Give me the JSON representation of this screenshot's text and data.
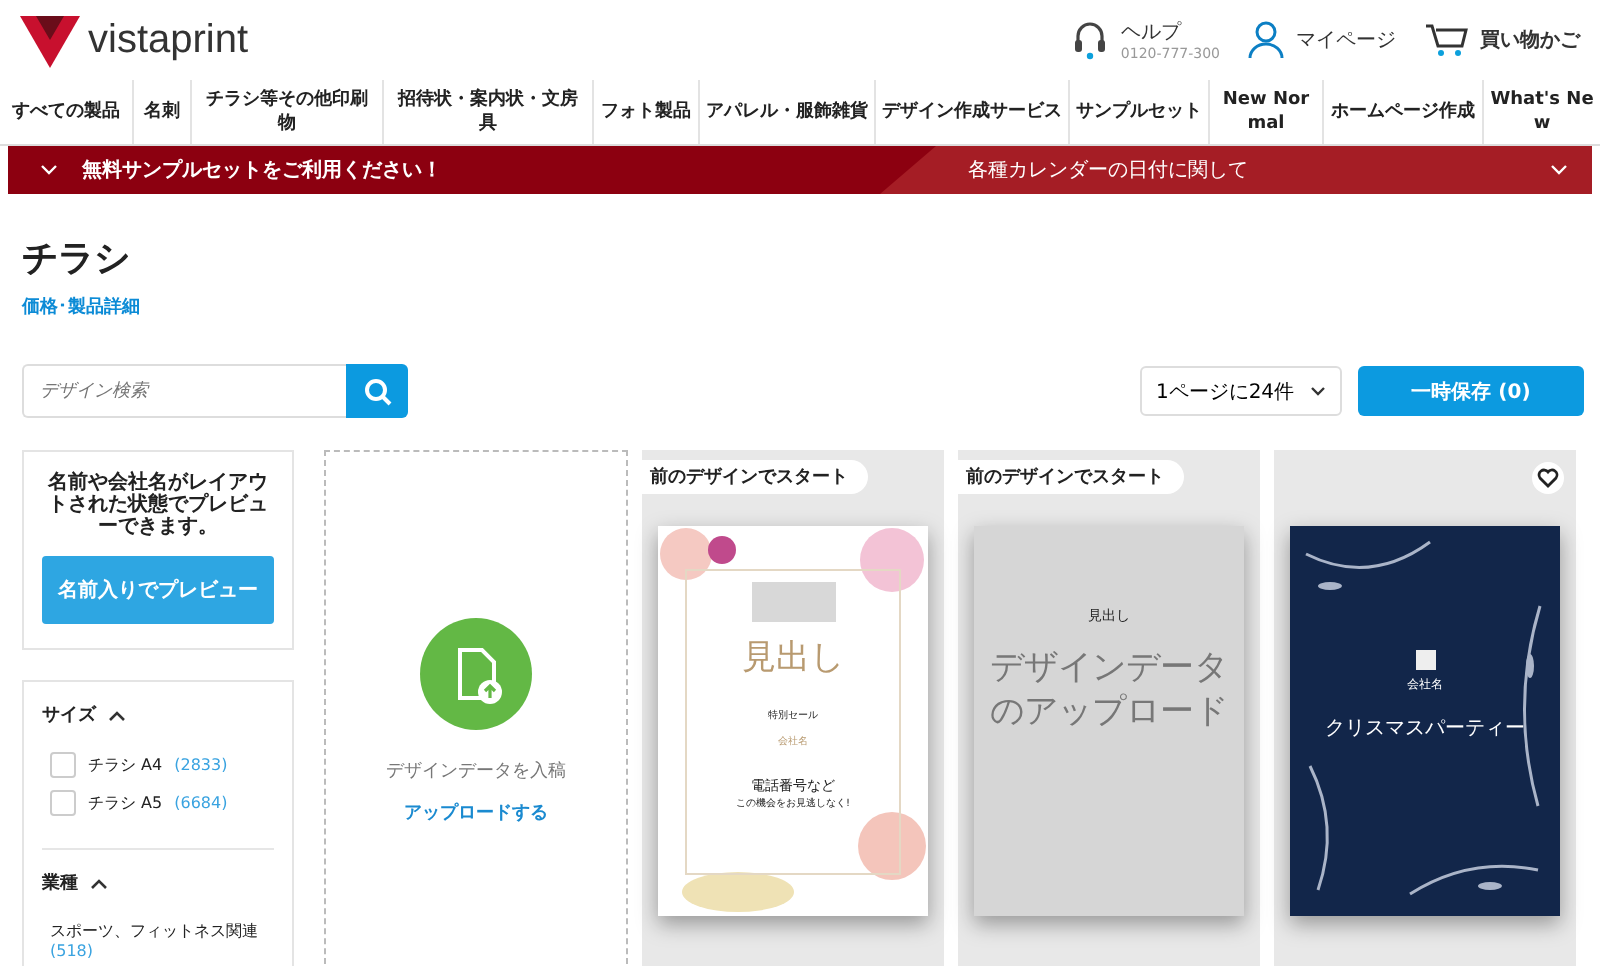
{
  "header": {
    "logo": "vistaprint",
    "help": {
      "label": "ヘルプ",
      "phone": "0120-777-300"
    },
    "account": "マイページ",
    "cart": "買い物かご"
  },
  "nav": [
    "すべての製品",
    "名刺",
    "チラシ等その他印刷物",
    "招待状・案内状・文房具",
    "フォト製品",
    "アパレル・服飾雑貨",
    "デザイン作成サービス",
    "サンプルセット",
    "New Normal",
    "ホームページ作成",
    "What's New"
  ],
  "promo": {
    "left": "無料サンプルセットをご利用ください！",
    "right": "各種カレンダーの日付に関して"
  },
  "page": {
    "title": "チラシ",
    "link": "価格･製品詳細"
  },
  "search": {
    "placeholder": "デザイン検索"
  },
  "per_page": "1ページに24件",
  "save_button": "一時保存 (0)",
  "preview_card": {
    "text": "名前や会社名がレイアウトされた状態でプレビューできます。",
    "button": "名前入りでプレビュー"
  },
  "filters": [
    {
      "title": "サイズ",
      "expanded": true,
      "options": [
        {
          "kind": "checkbox",
          "label": "チラシ A4",
          "count": "(2833)",
          "checked": false
        },
        {
          "kind": "checkbox",
          "label": "チラシ A5",
          "count": "(6684)",
          "checked": false
        }
      ]
    },
    {
      "title": "業種",
      "expanded": true,
      "options": [
        {
          "kind": "link",
          "label": "スポーツ、フィットネス関連",
          "count": "(518)"
        }
      ]
    }
  ],
  "upload": {
    "text": "デザインデータを入稿",
    "link": "アップロードする"
  },
  "designs": [
    {
      "kind": "floral",
      "badge": "前のデザインでスタート",
      "favorite": false,
      "texts": [
        "見出し",
        "特別セール",
        "会社名",
        "電話番号など",
        "この機会をお見逃しなく!"
      ]
    },
    {
      "kind": "upload",
      "badge": "前のデザインでスタート",
      "favorite": false,
      "texts": [
        "見出し",
        "デザインデータのアップロード"
      ]
    },
    {
      "kind": "navy",
      "favorite": true,
      "texts": [
        "会社名",
        "クリスマスパーティー"
      ]
    }
  ]
}
